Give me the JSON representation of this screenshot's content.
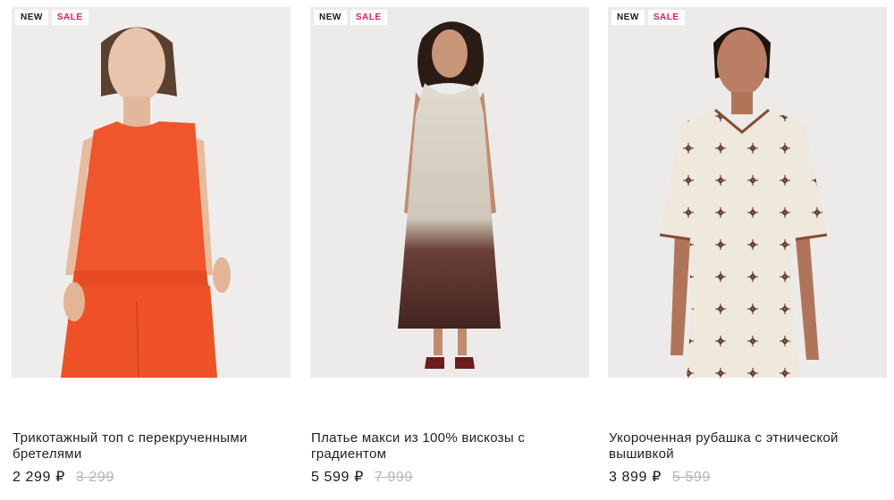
{
  "products": [
    {
      "badge_new": "NEW",
      "badge_sale": "SALE",
      "title": "Трикотажный топ с перекрученными бретелями",
      "price_now": "2 299 ₽",
      "price_old": "3 299",
      "colors": {
        "garment": "#f0552b",
        "background": "#ecebe9"
      }
    },
    {
      "badge_new": "NEW",
      "badge_sale": "SALE",
      "title": "Платье макси из 100% вискозы с градиентом",
      "price_now": "5 599 ₽",
      "price_old": "7 999",
      "colors": {
        "garment": "#d9d2c6",
        "gradient_end": "#4a2a24",
        "background": "#ecebe9"
      }
    },
    {
      "badge_new": "NEW",
      "badge_sale": "SALE",
      "title": "Укороченная рубашка с этнической вышивкой",
      "price_now": "3 899 ₽",
      "price_old": "5 599",
      "colors": {
        "garment": "#efe8dc",
        "embroidery": "#5a2e22",
        "background": "#ecebe9"
      }
    }
  ],
  "accent": {
    "sale": "#e6195a"
  }
}
